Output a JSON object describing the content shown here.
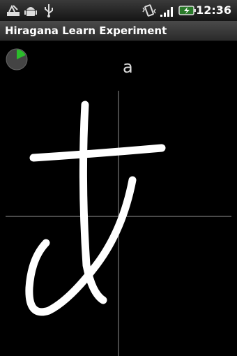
{
  "status_bar": {
    "time": "12:36",
    "icons": [
      "usb-debug-icon",
      "android-icon",
      "usb-icon",
      "vibrate-icon",
      "signal-icon",
      "battery-charging-icon"
    ]
  },
  "app": {
    "title": "Hiragana Learn Experiment"
  },
  "practice": {
    "target_romaji": "a",
    "progress_fraction": 0.18,
    "accent_color": "#2bbd2b"
  }
}
